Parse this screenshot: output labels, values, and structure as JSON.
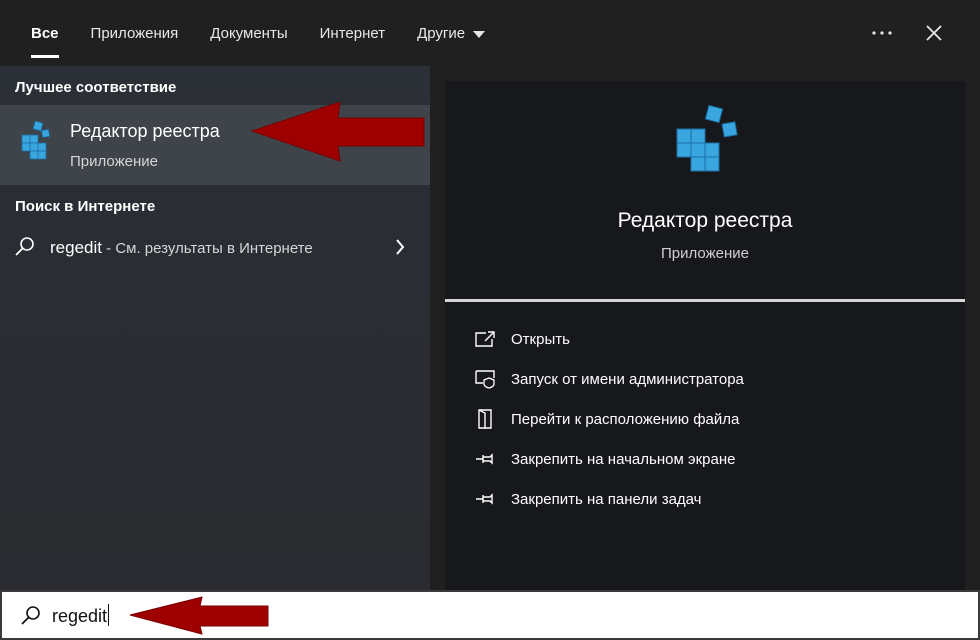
{
  "tabs": [
    {
      "label": "Все",
      "active": true
    },
    {
      "label": "Приложения"
    },
    {
      "label": "Документы"
    },
    {
      "label": "Интернет"
    },
    {
      "label": "Другие",
      "has_dropdown": true
    }
  ],
  "top_actions": {
    "more_icon": "more-icon",
    "close_icon": "close-icon"
  },
  "left": {
    "best_match_title": "Лучшее соответствие",
    "best_match": {
      "icon": "registry-editor-icon",
      "title": "Редактор реестра",
      "subtitle": "Приложение"
    },
    "web_section_title": "Поиск в Интернете",
    "web_result": {
      "query": "regedit",
      "rest": " - См. результаты в Интернете",
      "icon": "search-icon"
    }
  },
  "detail": {
    "icon": "registry-editor-icon",
    "title": "Редактор реестра",
    "subtitle": "Приложение",
    "actions": [
      {
        "label": "Открыть",
        "icon": "open-icon"
      },
      {
        "label": "Запуск от имени администратора",
        "icon": "shield-icon"
      },
      {
        "label": "Перейти к расположению файла",
        "icon": "file-location-icon"
      },
      {
        "label": "Закрепить на начальном экране",
        "icon": "pin-icon"
      },
      {
        "label": "Закрепить на панели задач",
        "icon": "pin-icon"
      }
    ]
  },
  "search": {
    "value": "regedit",
    "icon": "search-icon"
  },
  "colors": {
    "annotation_arrow": "#9e0000",
    "accent_cube": "#3aa6e0"
  }
}
